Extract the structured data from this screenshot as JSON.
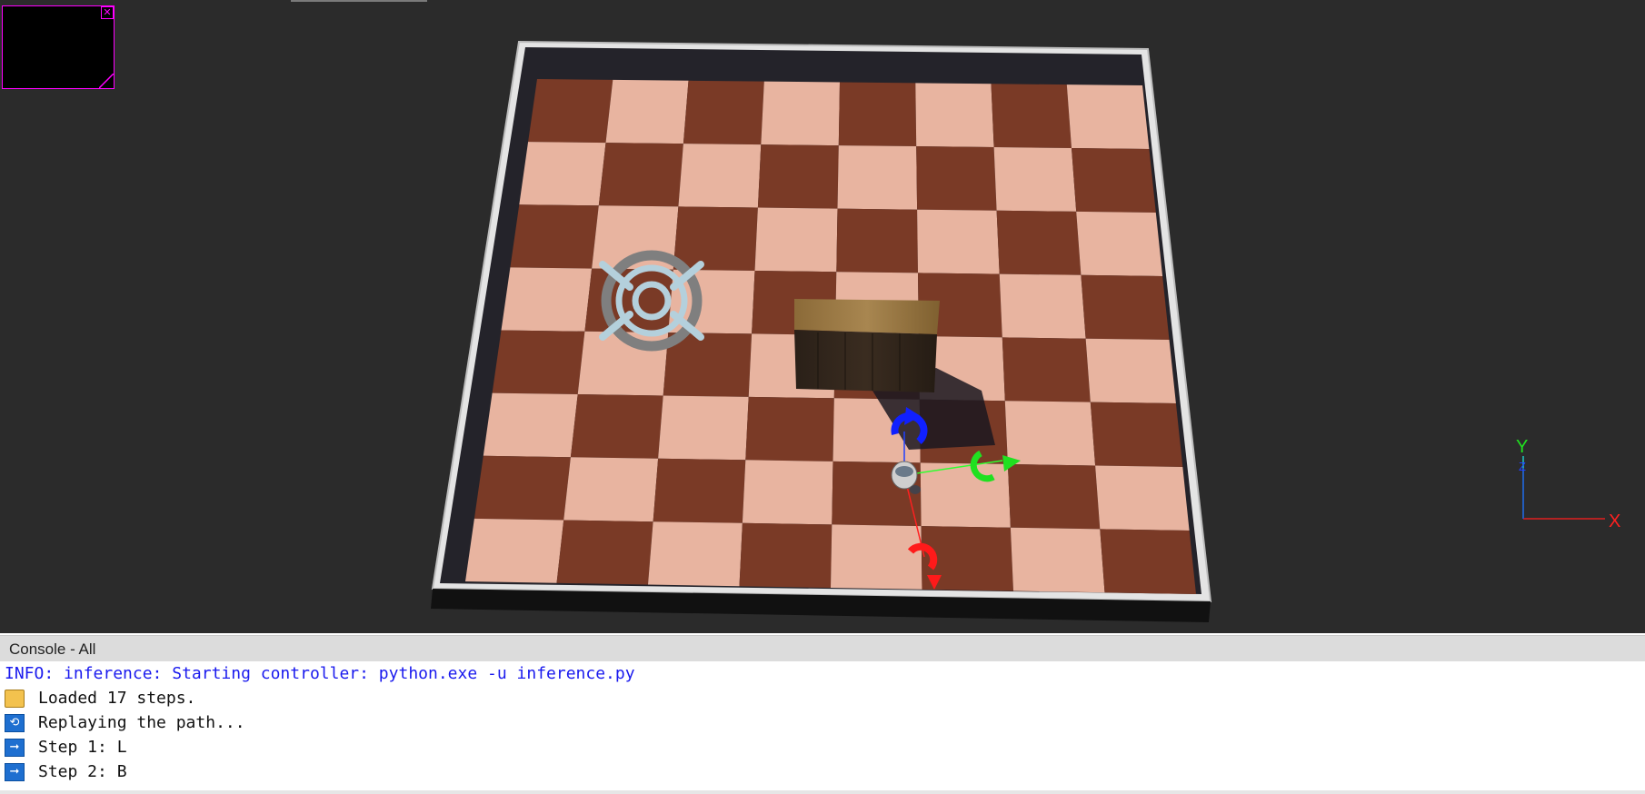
{
  "overlay": {
    "close_icon": "close-x-icon",
    "border_color": "#ff00ff"
  },
  "axis": {
    "y_label": "Y",
    "z_label": "Z",
    "x_label": "X"
  },
  "console": {
    "title": "Console - All",
    "lines": [
      {
        "text": "INFO: inference: Starting controller: python.exe -u inference.py",
        "icon": "",
        "color": "#1a1aee"
      },
      {
        "text": "Loaded 17 steps.",
        "icon": "folder-icon"
      },
      {
        "text": "Replaying the path...",
        "icon": "repeat-icon"
      },
      {
        "text": "Step 1: L",
        "icon": "arrow-right-icon"
      },
      {
        "text": "Step 2: B",
        "icon": "arrow-right-icon"
      }
    ]
  },
  "colors": {
    "board_dark": "#7a3a26",
    "board_light": "#e8b4a0",
    "axis_x": "#ff2020",
    "axis_y": "#20ff20",
    "axis_z": "#2040ff"
  }
}
